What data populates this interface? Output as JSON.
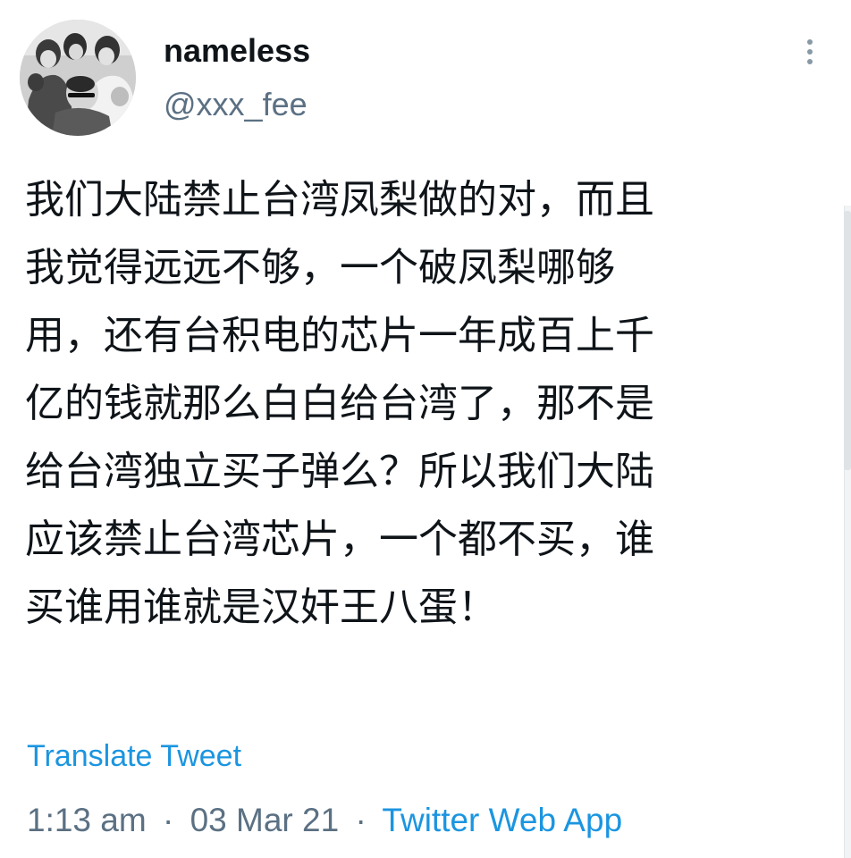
{
  "user": {
    "display_name": "nameless",
    "handle": "@xxx_fee",
    "avatar": "black-and-white-group-photo"
  },
  "tweet": {
    "lines": [
      "我们大陆禁止台湾凤梨做的对，而且",
      "我觉得远远不够，一个破凤梨哪够",
      "用，还有台积电的芯片一年成百上千",
      "亿的钱就那么白白给台湾了，那不是",
      "给台湾独立买子弹么？所以我们大陆",
      "应该禁止台湾芯片，一个都不买，谁",
      "买谁用谁就是汉奸王八蛋！"
    ],
    "translate_label": "Translate Tweet"
  },
  "meta": {
    "time": "1:13 am",
    "date": "03 Mar 21",
    "separator": "·",
    "source": "Twitter Web App"
  },
  "icons": {
    "more": "vertical-ellipsis-icon"
  },
  "colors": {
    "text": "#0f1419",
    "secondary": "#5b7083",
    "link": "#1b95e0"
  }
}
